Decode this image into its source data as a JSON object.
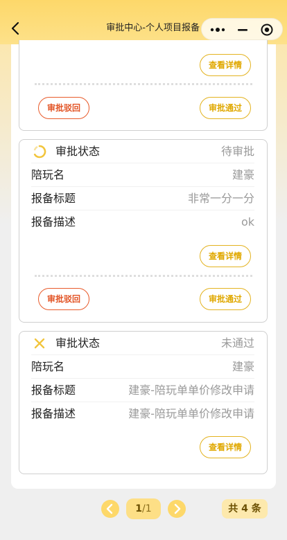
{
  "nav": {
    "title": "审批中心-个人项目报备"
  },
  "colors": {
    "accent": "#fdd86a",
    "detail_border": "#e3b21e",
    "reject": "#e25324",
    "muted_text": "#999999"
  },
  "card1": {
    "detail_label": "查看详情",
    "reject_label": "审批驳回",
    "pass_label": "审批通过"
  },
  "card2": {
    "status_label": "审批状态",
    "status_value": "待审批",
    "status_icon": "loading-spinner-icon",
    "rows": [
      {
        "label": "陪玩名",
        "value": "建豪"
      },
      {
        "label": "报备标题",
        "value": "非常一分一分"
      },
      {
        "label": "报备描述",
        "value": "ok"
      }
    ],
    "detail_label": "查看详情",
    "reject_label": "审批驳回",
    "pass_label": "审批通过"
  },
  "card3": {
    "status_label": "审批状态",
    "status_value": "未通过",
    "status_icon": "close-x-icon",
    "rows": [
      {
        "label": "陪玩名",
        "value": "建豪"
      },
      {
        "label": "报备标题",
        "value": "建豪-陪玩单单价修改申请"
      },
      {
        "label": "报备描述",
        "value": "建豪-陪玩单单价修改申请"
      }
    ],
    "detail_label": "查看详情"
  },
  "pagination": {
    "current": "1",
    "separator": "/",
    "total_pages": "1",
    "total_label": "共 4 条"
  }
}
